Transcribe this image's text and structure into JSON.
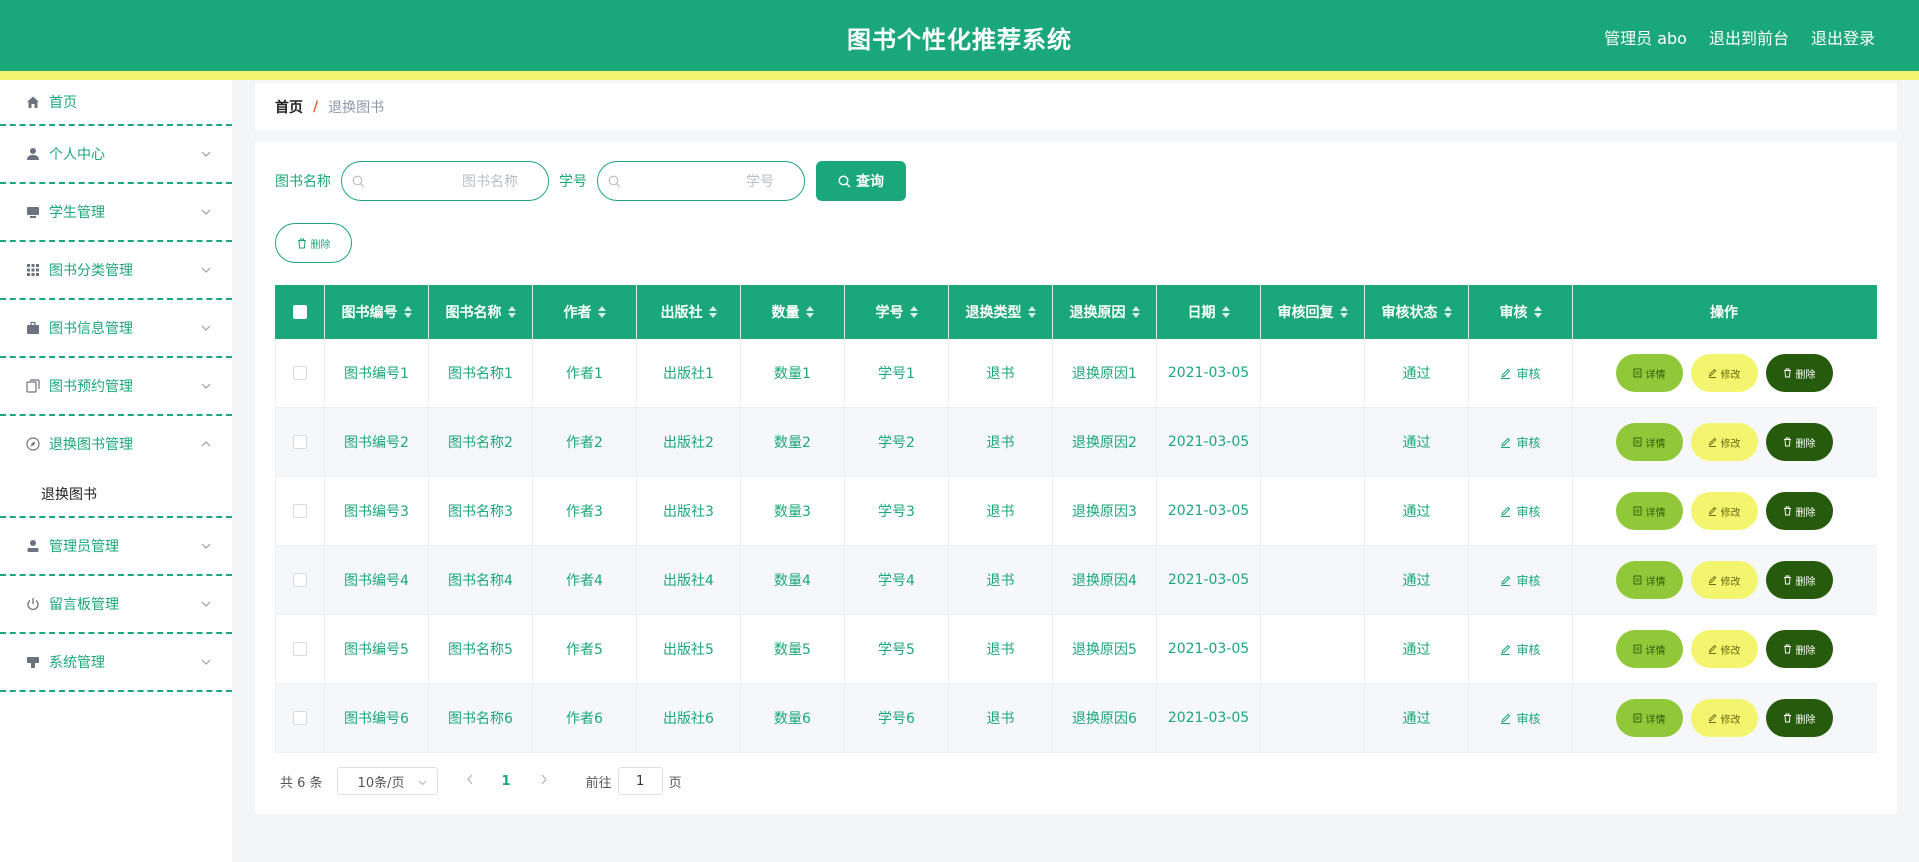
{
  "header": {
    "title": "图书个性化推荐系统",
    "user": "管理员 abo",
    "to_front": "退出到前台",
    "logout": "退出登录",
    "colors": {
      "primary": "#1aa779",
      "accent": "#f4f56e"
    }
  },
  "sidebar": {
    "items": [
      {
        "label": "首页",
        "icon": "home-icon"
      },
      {
        "label": "个人中心",
        "icon": "user-icon"
      },
      {
        "label": "学生管理",
        "icon": "monitor-icon"
      },
      {
        "label": "图书分类管理",
        "icon": "grid-icon"
      },
      {
        "label": "图书信息管理",
        "icon": "briefcase-icon"
      },
      {
        "label": "图书预约管理",
        "icon": "copy-icon"
      },
      {
        "label": "退换图书管理",
        "icon": "compass-icon"
      },
      {
        "label": "管理员管理",
        "icon": "admin-icon"
      },
      {
        "label": "留言板管理",
        "icon": "power-icon"
      },
      {
        "label": "系统管理",
        "icon": "stamp-icon"
      }
    ],
    "submenu_label": "退换图书"
  },
  "breadcrumb": {
    "home": "首页",
    "sep": "/",
    "current": "退换图书"
  },
  "search": {
    "book_name_label": "图书名称",
    "book_name_placeholder": "图书名称",
    "student_no_label": "学号",
    "student_no_placeholder": "学号",
    "query_button": "查询",
    "delete_button": "删除"
  },
  "table": {
    "columns": [
      "图书编号",
      "图书名称",
      "作者",
      "出版社",
      "数量",
      "学号",
      "退换类型",
      "退换原因",
      "日期",
      "审核回复",
      "审核状态",
      "审核",
      "操作"
    ],
    "rows": [
      [
        "图书编号1",
        "图书名称1",
        "作者1",
        "出版社1",
        "数量1",
        "学号1",
        "退书",
        "退换原因1",
        "2021-03-05",
        "",
        "通过"
      ],
      [
        "图书编号2",
        "图书名称2",
        "作者2",
        "出版社2",
        "数量2",
        "学号2",
        "退书",
        "退换原因2",
        "2021-03-05",
        "",
        "通过"
      ],
      [
        "图书编号3",
        "图书名称3",
        "作者3",
        "出版社3",
        "数量3",
        "学号3",
        "退书",
        "退换原因3",
        "2021-03-05",
        "",
        "通过"
      ],
      [
        "图书编号4",
        "图书名称4",
        "作者4",
        "出版社4",
        "数量4",
        "学号4",
        "退书",
        "退换原因4",
        "2021-03-05",
        "",
        "通过"
      ],
      [
        "图书编号5",
        "图书名称5",
        "作者5",
        "出版社5",
        "数量5",
        "学号5",
        "退书",
        "退换原因5",
        "2021-03-05",
        "",
        "通过"
      ],
      [
        "图书编号6",
        "图书名称6",
        "作者6",
        "出版社6",
        "数量6",
        "学号6",
        "退书",
        "退换原因6",
        "2021-03-05",
        "",
        "通过"
      ]
    ],
    "audit_label": "审核",
    "op_detail": "详情",
    "op_edit": "修改",
    "op_delete": "删除"
  },
  "pager": {
    "total": "共 6 条",
    "page_size": "10条/页",
    "current_page": "1",
    "goto_label": "前往",
    "goto_value": "1",
    "page_unit": "页"
  }
}
